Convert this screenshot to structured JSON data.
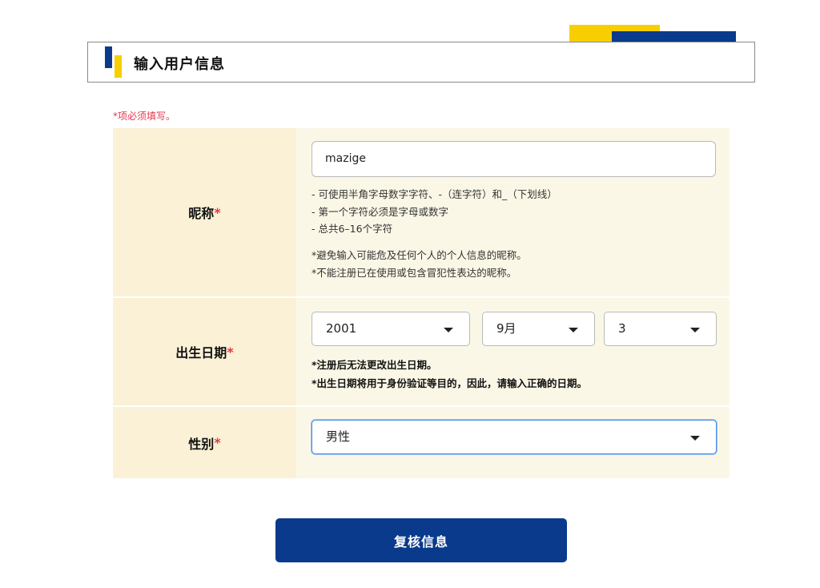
{
  "header": {
    "title": "输入用户信息"
  },
  "required_note": "*项必须填写。",
  "nickname": {
    "label": "昵称",
    "required_mark": "*",
    "value": "mazige",
    "hints": [
      "- 可使用半角字母数字字符、-（连字符）和_（下划线）",
      "- 第一个字符必须是字母或数字",
      "- 总共6–16个字符"
    ],
    "notes": [
      "*避免输入可能危及任何个人的个人信息的昵称。",
      "*不能注册已在使用或包含冒犯性表达的昵称。"
    ]
  },
  "birthdate": {
    "label": "出生日期",
    "required_mark": "*",
    "year": "2001",
    "month": "9月",
    "day": "3",
    "notes": [
      "*注册后无法更改出生日期。",
      "*出生日期将用于身份验证等目的，因此，请输入正确的日期。"
    ]
  },
  "gender": {
    "label": "性别",
    "required_mark": "*",
    "value": "男性"
  },
  "submit_button": "复核信息",
  "colors": {
    "brand_blue": "#0a3a8c",
    "brand_yellow": "#f7cf00",
    "required_red": "#e8354b"
  }
}
